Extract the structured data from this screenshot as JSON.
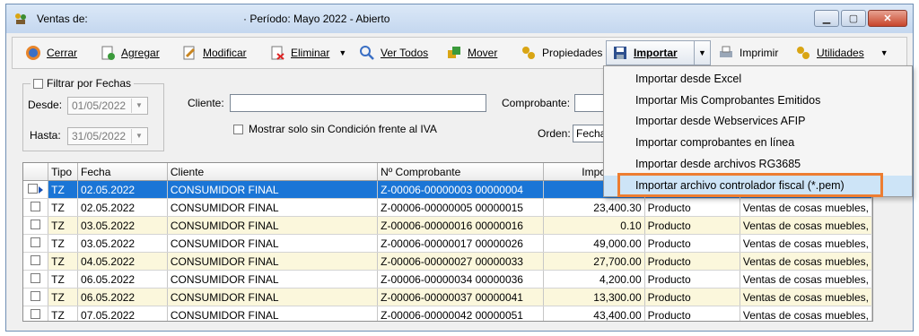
{
  "window": {
    "title": "Ventas de:",
    "period": "· Período: Mayo 2022 - Abierto",
    "icons": [
      "app-icon",
      "minimize-icon",
      "maximize-icon",
      "close-icon"
    ]
  },
  "toolbar": {
    "cerrar": "Cerrar",
    "agregar": "Agregar",
    "modificar": "Modificar",
    "eliminar": "Eliminar",
    "ver_todos": "Ver Todos",
    "mover": "Mover",
    "propiedades": "Propiedades",
    "importar": "Importar",
    "imprimir": "Imprimir",
    "utilidades": "Utilidades"
  },
  "filters": {
    "filtrar_por_fechas": "Filtrar por Fechas",
    "desde_label": "Desde:",
    "desde_value": "01/05/2022",
    "hasta_label": "Hasta:",
    "hasta_value": "31/05/2022",
    "cliente_label": "Cliente:",
    "cliente_value": "",
    "comprobante_label": "Comprobante:",
    "mostrar_label": "Mostrar solo sin Condición frente al IVA",
    "orden_label": "Orden:",
    "orden_value": "Fecha"
  },
  "grid": {
    "columns": [
      "",
      "Tipo",
      "Fecha",
      "Cliente",
      "Nº Comprobante",
      "Impo",
      "",
      ""
    ],
    "rows": [
      {
        "tipo": "TZ",
        "fecha": "02.05.2022",
        "cliente": "CONSUMIDOR FINAL",
        "comprobante": "Z-00006-00000003 00000004",
        "importe": "",
        "categoria": "",
        "concepto": ""
      },
      {
        "tipo": "TZ",
        "fecha": "02.05.2022",
        "cliente": "CONSUMIDOR FINAL",
        "comprobante": "Z-00006-00000005 00000015",
        "importe": "23,400.30",
        "categoria": "Producto",
        "concepto": "Ventas de cosas muebles,"
      },
      {
        "tipo": "TZ",
        "fecha": "03.05.2022",
        "cliente": "CONSUMIDOR FINAL",
        "comprobante": "Z-00006-00000016 00000016",
        "importe": "0.10",
        "categoria": "Producto",
        "concepto": "Ventas de cosas muebles,"
      },
      {
        "tipo": "TZ",
        "fecha": "03.05.2022",
        "cliente": "CONSUMIDOR FINAL",
        "comprobante": "Z-00006-00000017 00000026",
        "importe": "49,000.00",
        "categoria": "Producto",
        "concepto": "Ventas de cosas muebles,"
      },
      {
        "tipo": "TZ",
        "fecha": "04.05.2022",
        "cliente": "CONSUMIDOR FINAL",
        "comprobante": "Z-00006-00000027 00000033",
        "importe": "27,700.00",
        "categoria": "Producto",
        "concepto": "Ventas de cosas muebles,"
      },
      {
        "tipo": "TZ",
        "fecha": "06.05.2022",
        "cliente": "CONSUMIDOR FINAL",
        "comprobante": "Z-00006-00000034 00000036",
        "importe": "4,200.00",
        "categoria": "Producto",
        "concepto": "Ventas de cosas muebles,"
      },
      {
        "tipo": "TZ",
        "fecha": "06.05.2022",
        "cliente": "CONSUMIDOR FINAL",
        "comprobante": "Z-00006-00000037 00000041",
        "importe": "13,300.00",
        "categoria": "Producto",
        "concepto": "Ventas de cosas muebles,"
      },
      {
        "tipo": "TZ",
        "fecha": "07.05.2022",
        "cliente": "CONSUMIDOR FINAL",
        "comprobante": "Z-00006-00000042 00000051",
        "importe": "43,400.00",
        "categoria": "Producto",
        "concepto": "Ventas de cosas muebles,"
      }
    ]
  },
  "import_menu": {
    "items": [
      "Importar desde Excel",
      "Importar Mis Comprobantes Emitidos",
      "Importar desde Webservices AFIP",
      "Importar comprobantes en línea",
      "Importar desde archivos RG3685",
      "Importar archivo controlador fiscal  (*.pem)"
    ],
    "highlighted_index": 5
  },
  "colors": {
    "selection": "#1a75d6",
    "alt_row": "#fbf7dc",
    "menu_highlight": "#cde4f7",
    "annotation_box": "#ed7d31"
  }
}
